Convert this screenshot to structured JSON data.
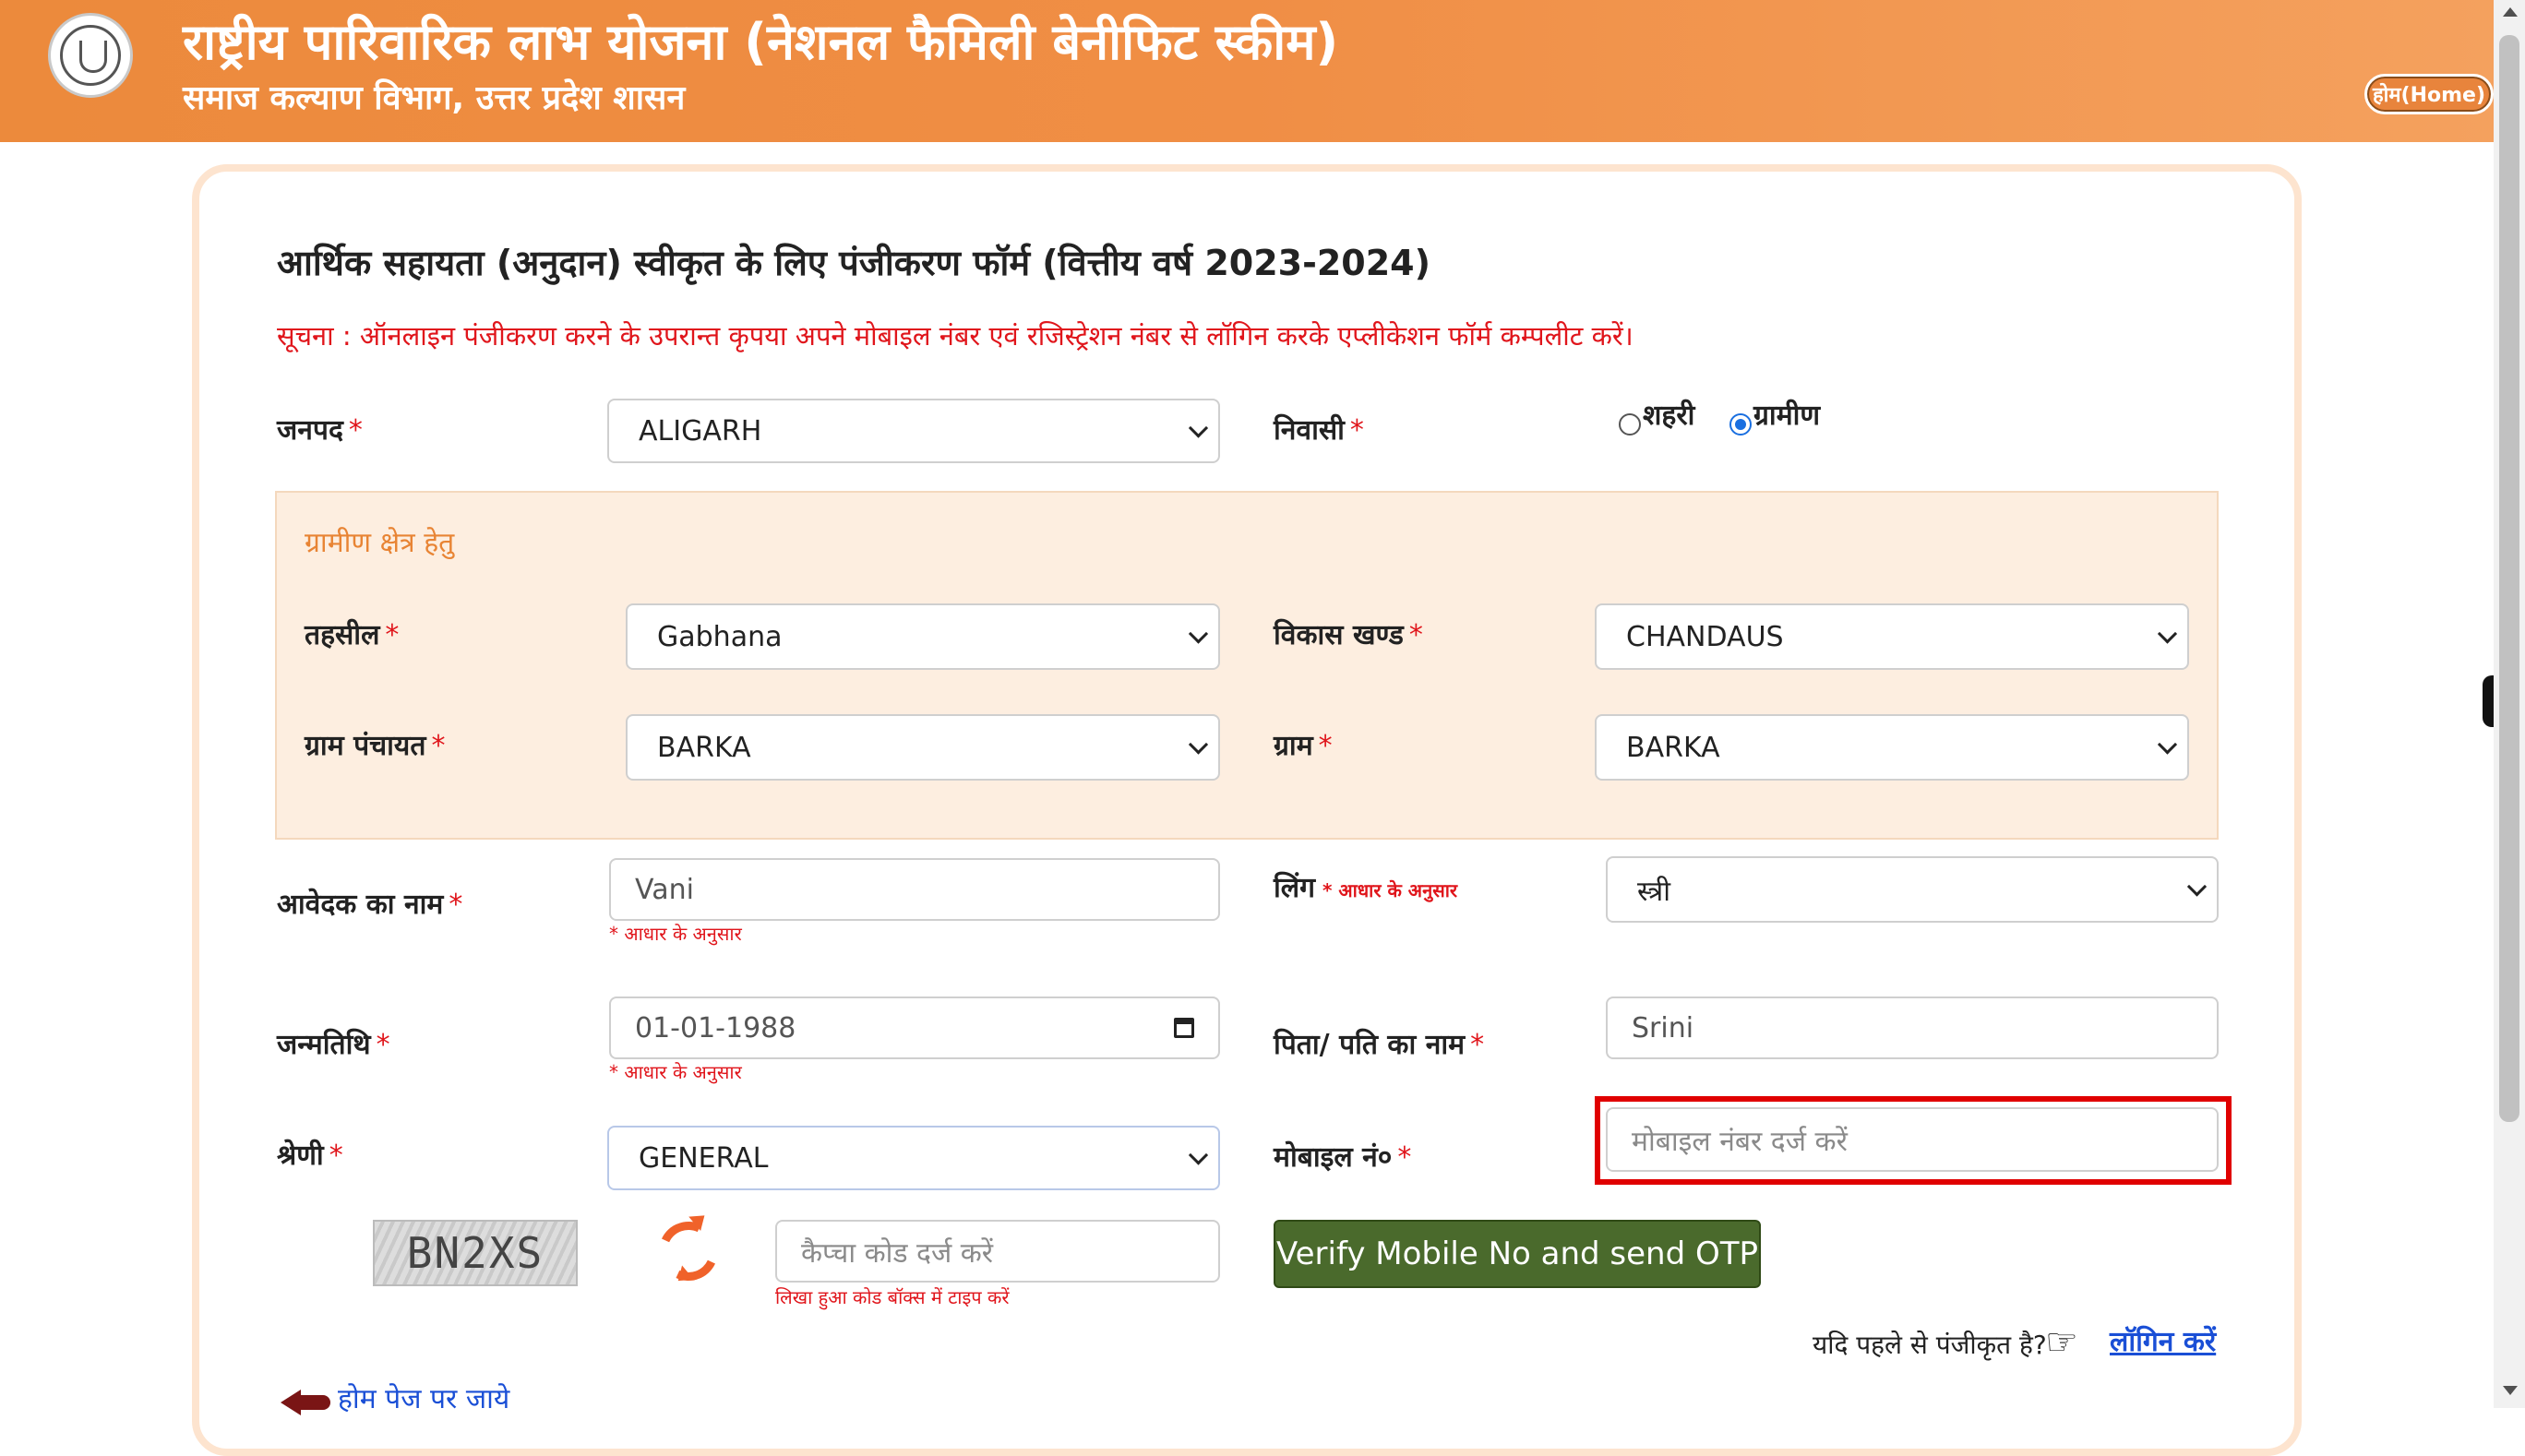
{
  "header": {
    "title": "राष्ट्रीय पारिवारिक लाभ योजना (नेशनल फैमिली बेनीफिट स्कीम)",
    "subtitle": "समाज कल्याण विभाग, उत्तर प्रदेश शासन",
    "home_button": "होम(Home)"
  },
  "form": {
    "title": "आर्थिक सहायता (अनुदान) स्वीकृत के लिए पंजीकरण फॉर्म (वित्तीय वर्ष 2023-2024)",
    "notice": "सूचना : ऑनलाइन पंजीकरण करने के उपरान्त कृपया अपने मोबाइल नंबर एवं रजिस्ट्रेशन नंबर से लॉगिन करके एप्लीकेशन फॉर्म कम्पलीट करें।",
    "required_mark": "*",
    "district": {
      "label": "जनपद",
      "value": "ALIGARH"
    },
    "residence": {
      "label": "निवासी",
      "option_urban": "शहरी",
      "option_rural": "ग्रामीण",
      "selected": "ग्रामीण"
    },
    "rural_section": {
      "title": "ग्रामीण क्षेत्र हेतु",
      "tehsil": {
        "label": "तहसील",
        "value": "Gabhana"
      },
      "block": {
        "label": "विकास खण्ड",
        "value": "CHANDAUS"
      },
      "gram_panchayat": {
        "label": "ग्राम पंचायत",
        "value": "BARKA"
      },
      "village": {
        "label": "ग्राम",
        "value": "BARKA"
      }
    },
    "applicant_name": {
      "label": "आवेदक का नाम",
      "value": "Vani",
      "hint": "* आधार के अनुसार"
    },
    "gender": {
      "label": "लिंग",
      "hint": "* आधार के अनुसार",
      "value": "स्त्री"
    },
    "dob": {
      "label": "जन्मतिथि",
      "value": "01-01-1988",
      "hint": "* आधार के अनुसार"
    },
    "father_husband_name": {
      "label": "पिता/ पति का नाम",
      "value": "Srini"
    },
    "category": {
      "label": "श्रेणी",
      "value": "GENERAL"
    },
    "mobile": {
      "label": "मोबाइल नं०",
      "placeholder": "मोबाइल नंबर दर्ज करें"
    },
    "captcha": {
      "code": "BN2XS",
      "placeholder": "कैप्चा कोड दर्ज करें",
      "hint": "लिखा हुआ कोड बॉक्स में टाइप करें"
    },
    "otp_button": "Verify Mobile No and send OTP",
    "already_registered": "यदि पहले से पंजीकृत है?",
    "login_link": "लॉगिन करें",
    "home_page_link": "होम पेज पर जाये"
  },
  "colors": {
    "header": "#f08e45",
    "required": "#e0151b",
    "button": "#4a6a2c",
    "link": "#1a4fd6",
    "highlight": "#e00000"
  }
}
